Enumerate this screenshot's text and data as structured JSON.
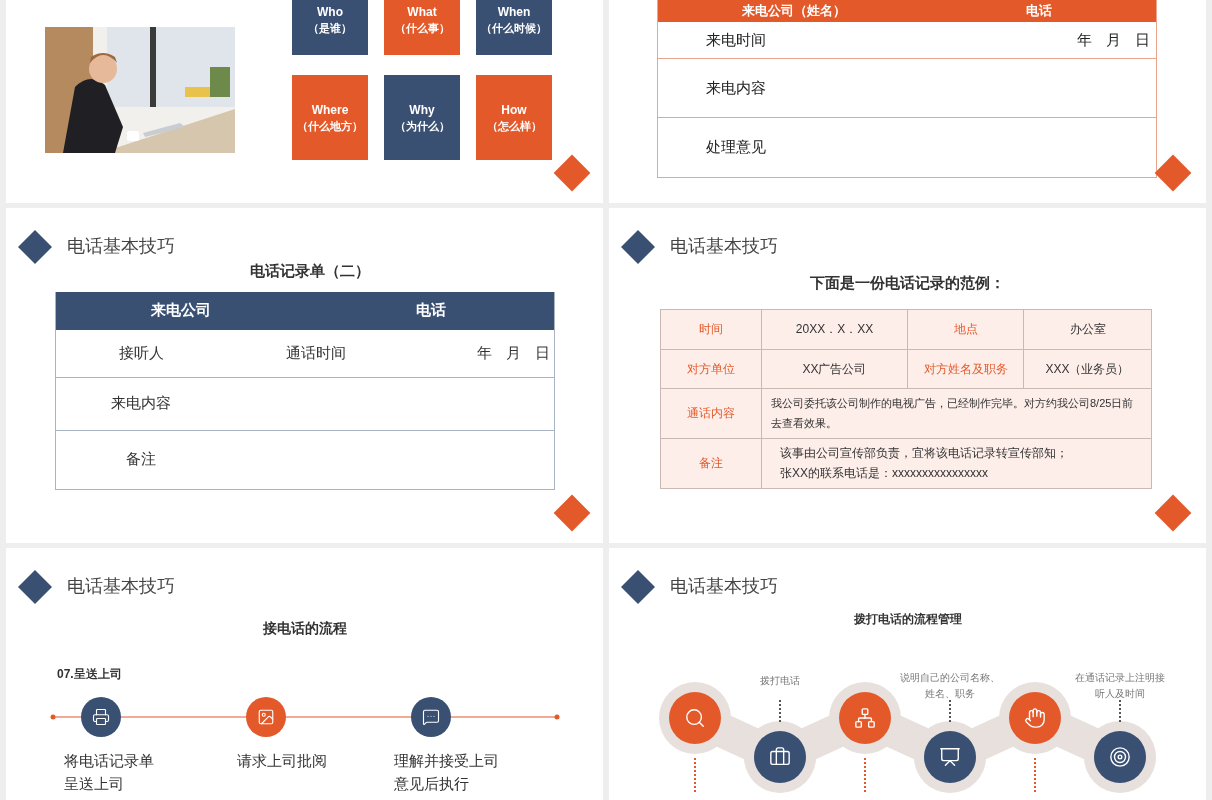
{
  "slides": [
    {
      "kind": "five_w",
      "tiles": [
        {
          "label": "Who",
          "sub": "（是谁）",
          "color": "#3a5073"
        },
        {
          "label": "What",
          "sub": "（什么事）",
          "color": "#e4592a"
        },
        {
          "label": "When",
          "sub": "（什么时候）",
          "color": "#3a5073"
        },
        {
          "label": "Where",
          "sub": "（什么地方）",
          "color": "#e4592a"
        },
        {
          "label": "Why",
          "sub": "（为什么）",
          "color": "#3a5073"
        },
        {
          "label": "How",
          "sub": "（怎么样）",
          "color": "#e4592a"
        }
      ]
    },
    {
      "kind": "form_orange",
      "header": [
        "来电公司（姓名）",
        "电话"
      ],
      "rows": [
        {
          "label": "来电时间",
          "date": [
            "年",
            "月",
            "日"
          ]
        },
        {
          "label": "来电内容"
        },
        {
          "label": "处理意见"
        }
      ]
    },
    {
      "kind": "form_navy",
      "title": "电话基本技巧",
      "subtitle": "电话记录单（二）",
      "header": [
        "来电公司",
        "电话"
      ],
      "rows": [
        {
          "label": "接听人",
          "middle": "通话时间",
          "date": [
            "年",
            "月",
            "日"
          ]
        },
        {
          "label": "来电内容"
        },
        {
          "label": "备注"
        }
      ]
    },
    {
      "kind": "example",
      "title": "电话基本技巧",
      "subtitle": "下面是一份电话记录的范例：",
      "rows": [
        [
          {
            "kind": "label",
            "text": "时间"
          },
          {
            "kind": "value",
            "text": "20XX．X．XX"
          },
          {
            "kind": "label",
            "text": "地点"
          },
          {
            "kind": "value",
            "text": "办公室"
          }
        ],
        [
          {
            "kind": "label",
            "text": "对方单位"
          },
          {
            "kind": "value",
            "text": "XX广告公司"
          },
          {
            "kind": "label",
            "text": "对方姓名及职务"
          },
          {
            "kind": "value",
            "text": "XXX（业务员）"
          }
        ],
        [
          {
            "kind": "label",
            "text": "通话内容"
          },
          {
            "kind": "value",
            "text": "我公司委托该公司制作的电视广告，已经制作完毕。对方约我公司8/25日前去查看效果。"
          }
        ],
        [
          {
            "kind": "label",
            "text": "备注"
          },
          {
            "kind": "value",
            "lines": [
              "该事由公司宣传部负责，宜将该电话记录转宣传部知；",
              "张XX的联系电话是：xxxxxxxxxxxxxxxx"
            ]
          }
        ]
      ]
    },
    {
      "kind": "flow",
      "title": "电话基本技巧",
      "subtitle": "接电话的流程",
      "step_title": "07.呈送上司",
      "steps": [
        {
          "color": "#3a5073",
          "lines": [
            "将电话记录单",
            "呈送上司"
          ]
        },
        {
          "color": "#e4592a",
          "lines": [
            "请求上司批阅"
          ]
        },
        {
          "color": "#3a5073",
          "lines": [
            "理解并接受上司",
            "意见后执行"
          ]
        }
      ]
    },
    {
      "kind": "chain",
      "title": "电话基本技巧",
      "subtitle": "拨打电话的流程管理",
      "steps": [
        {
          "color": "#e4592a"
        },
        {
          "color": "#3a5073",
          "lines": [
            "拨打电话"
          ]
        },
        {
          "color": "#e4592a"
        },
        {
          "color": "#3a5073",
          "lines": [
            "说明自己的公司名称、",
            "姓名、职务"
          ]
        },
        {
          "color": "#e4592a"
        },
        {
          "color": "#3a5073",
          "lines": [
            "在通话记录上注明接",
            "听人及时间"
          ]
        }
      ]
    }
  ]
}
